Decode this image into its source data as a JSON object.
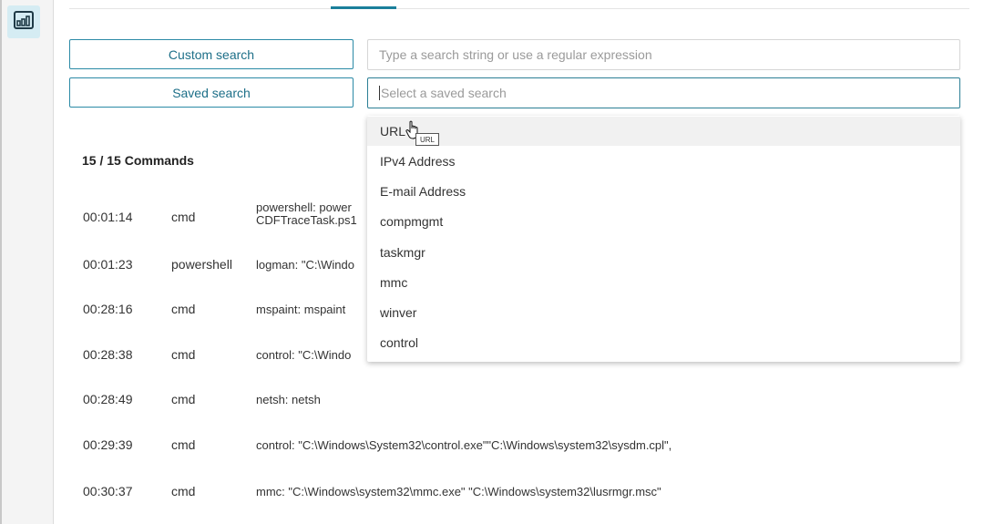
{
  "header": {
    "rail_icon": "chart-dashboard-icon"
  },
  "search": {
    "custom_label": "Custom search",
    "saved_label": "Saved search",
    "search_placeholder": "Type a search string or use a regular expression",
    "saved_placeholder": "Select a saved search"
  },
  "commands": {
    "count": "15 / 15 Commands",
    "rows": [
      {
        "time": "00:01:14",
        "proc": "cmd",
        "text_line1": "powershell: power",
        "text_line2": "CDFTraceTask.ps1"
      },
      {
        "time": "00:01:23",
        "proc": "powershell",
        "text_line1": "logman: \"C:\\Windo"
      },
      {
        "time": "00:28:16",
        "proc": "cmd",
        "text_line1": "mspaint: mspaint"
      },
      {
        "time": "00:28:38",
        "proc": "cmd",
        "text_line1": "control: \"C:\\Windo"
      },
      {
        "time": "00:28:49",
        "proc": "cmd",
        "text_line1": "netsh: netsh"
      },
      {
        "time": "00:29:39",
        "proc": "cmd",
        "text_line1": "control: \"C:\\Windows\\System32\\control.exe\"\"C:\\Windows\\system32\\sysdm.cpl\","
      },
      {
        "time": "00:30:37",
        "proc": "cmd",
        "text_line1": "mmc: \"C:\\Windows\\system32\\mmc.exe\" \"C:\\Windows\\system32\\lusrmgr.msc\""
      }
    ]
  },
  "dropdown": {
    "options": [
      "URL",
      "IPv4 Address",
      "E-mail Address",
      "compmgmt",
      "taskmgr",
      "mmc",
      "winver",
      "control"
    ],
    "tooltip": "URL"
  },
  "colors": {
    "accent": "#1b7f9b",
    "button_text": "#1d6f88"
  }
}
